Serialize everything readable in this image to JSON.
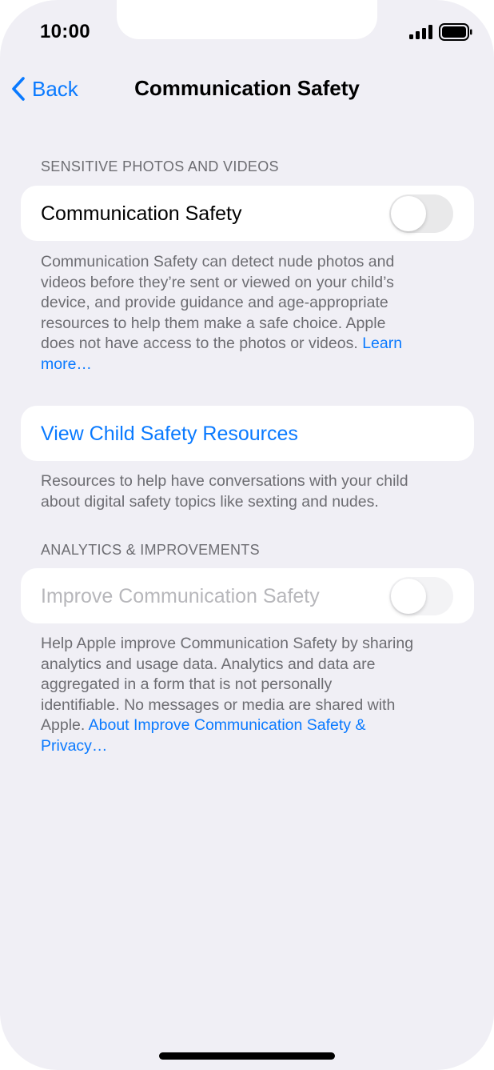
{
  "status_bar": {
    "time": "10:00"
  },
  "nav": {
    "back_label": "Back",
    "title": "Communication Safety"
  },
  "sections": {
    "sensitive": {
      "header": "SENSITIVE PHOTOS AND VIDEOS",
      "toggle_label": "Communication Safety",
      "toggle_on": false,
      "footer_lines": [
        "Communication Safety can detect nude photos and",
        "videos before they’re sent or viewed on your child’s",
        "device, and provide guidance and age-appropriate",
        "resources to help them make a safe choice. Apple",
        "does not have access to the photos or videos."
      ],
      "learn_more_part1": "Learn",
      "learn_more_part2": "more…"
    },
    "resources": {
      "link_label": "View Child Safety Resources",
      "footer_lines": [
        "Resources to help have conversations with your child",
        "about digital safety topics like sexting and nudes."
      ]
    },
    "analytics": {
      "header": "ANALYTICS & IMPROVEMENTS",
      "toggle_label": "Improve Communication Safety",
      "toggle_on": false,
      "toggle_enabled": false,
      "footer_lines": [
        "Help Apple improve Communication Safety by sharing",
        "analytics and usage data. Analytics and data are",
        "aggregated in a form that is not personally",
        "identifiable. No messages or media are shared with"
      ],
      "footer_last_prefix": "Apple.",
      "about_link_part1": "About Improve Communication Safety &",
      "about_link_part2": "Privacy…"
    }
  },
  "colors": {
    "accent": "#0a7aff",
    "background": "#f0eff5",
    "secondary_text": "#6d6d72",
    "disabled_text": "#b7b7bb"
  }
}
